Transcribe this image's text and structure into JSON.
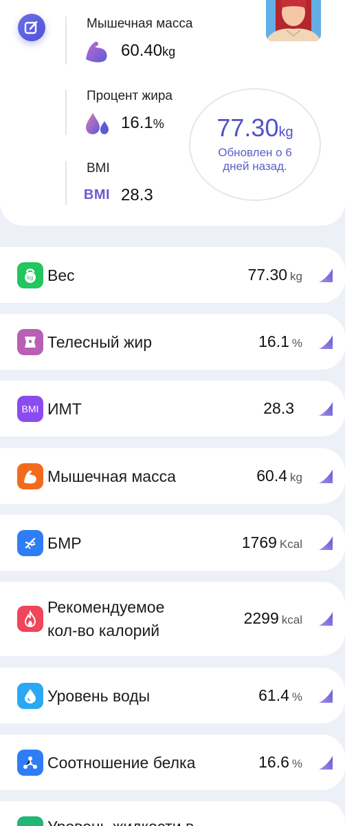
{
  "summary": {
    "muscle": {
      "label": "Мышечная масса",
      "value": "60.40",
      "unit": "kg"
    },
    "fat": {
      "label": "Процент жира",
      "value": "16.1",
      "unit": "%"
    },
    "bmi": {
      "label": "BMI",
      "icon_text": "BMI",
      "value": "28.3"
    },
    "weight": {
      "value": "77.30",
      "unit": "kg",
      "updated": "Обновлен о 6 дней назад."
    }
  },
  "rows": [
    {
      "label": "Вес",
      "value": "77.30",
      "unit": "kg",
      "icon": "kettlebell-icon",
      "color": "#22c55e"
    },
    {
      "label": "Телесный жир",
      "value": "16.1",
      "unit": "%",
      "icon": "body-fat-icon",
      "color": "#b95fb5"
    },
    {
      "label": "ИМТ",
      "value": "28.3",
      "unit": "",
      "icon_text": "BMI",
      "icon": "bmi-icon",
      "color": "#8a4cf0"
    },
    {
      "label": "Мышечная масса",
      "value": "60.4",
      "unit": "kg",
      "icon": "muscle-icon",
      "color": "#f26b1d"
    },
    {
      "label": "БМР",
      "value": "1769",
      "unit": "Kcal",
      "icon": "dna-icon",
      "color": "#2f7df6"
    },
    {
      "label": "Рекомендуемое кол-во калорий",
      "value": "2299",
      "unit": "kcal",
      "icon": "flame-icon",
      "color": "#f0455a"
    },
    {
      "label": "Уровень воды",
      "value": "61.4",
      "unit": "%",
      "icon": "water-drop-icon",
      "color": "#2aa8f2"
    },
    {
      "label": "Соотношение белка",
      "value": "16.6",
      "unit": "%",
      "icon": "protein-icon",
      "color": "#2f7df6"
    },
    {
      "label": "Уровень жидкости в",
      "value": "",
      "unit": "",
      "icon": "fluid-icon",
      "color": "#22b573"
    }
  ]
}
